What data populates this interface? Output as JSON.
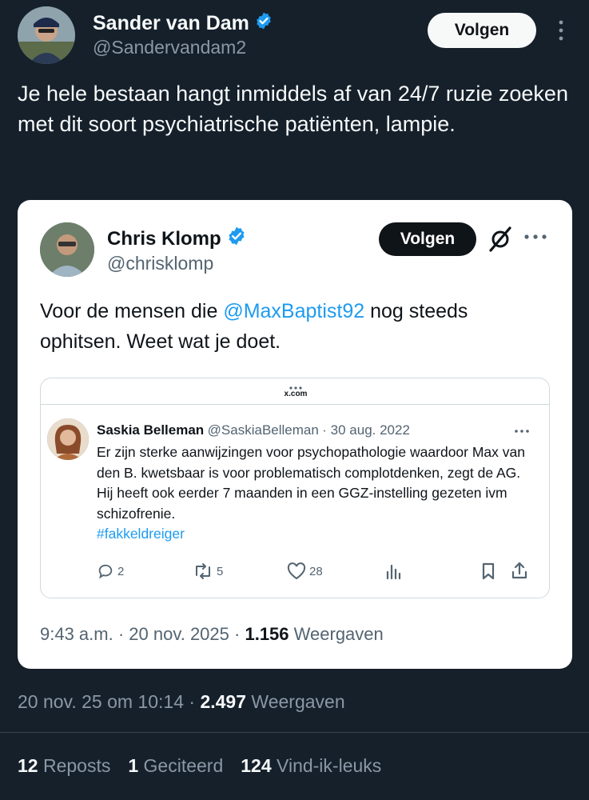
{
  "author": {
    "name": "Sander van Dam",
    "handle": "@Sandervandam2",
    "follow_label": "Volgen"
  },
  "tweet": {
    "text": "Je hele bestaan hangt inmiddels af van 24/7 ruzie zoeken met dit soort psychiatrische patiënten, lampie."
  },
  "quote": {
    "name": "Chris Klomp",
    "handle": "@chrisklomp",
    "follow_label": "Volgen",
    "text_before": "Voor de mensen die ",
    "mention": "@MaxBaptist92",
    "text_after": " nog steeds ophitsen. Weet wat je doet.",
    "time": "9:43 a.m.",
    "date": "20 nov. 2025",
    "views_count": "1.156",
    "views_label": "Weergaven"
  },
  "embedded": {
    "url": "x.com",
    "name": "Saskia Belleman",
    "handle": "@SaskiaBelleman",
    "date": "30 aug. 2022",
    "text": "Er zijn sterke aanwijzingen voor psychopathologie waardoor Max van den B. kwetsbaar is voor problematisch complotdenken, zegt de AG. Hij heeft ook eerder 7 maanden in een GGZ-instelling gezeten ivm schizofrenie.",
    "hashtag": "#fakkeldreiger",
    "replies": "2",
    "reposts": "5",
    "likes": "28"
  },
  "meta": {
    "date": "20 nov. 25 om 10:14",
    "views_count": "2.497",
    "views_label": "Weergaven"
  },
  "stats": {
    "reposts_count": "12",
    "reposts_label": "Reposts",
    "quotes_count": "1",
    "quotes_label": "Geciteerd",
    "likes_count": "124",
    "likes_label": "Vind-ik-leuks"
  },
  "colors": {
    "background": "#15202b",
    "accent": "#1d9bf0",
    "card": "#ffffff"
  }
}
